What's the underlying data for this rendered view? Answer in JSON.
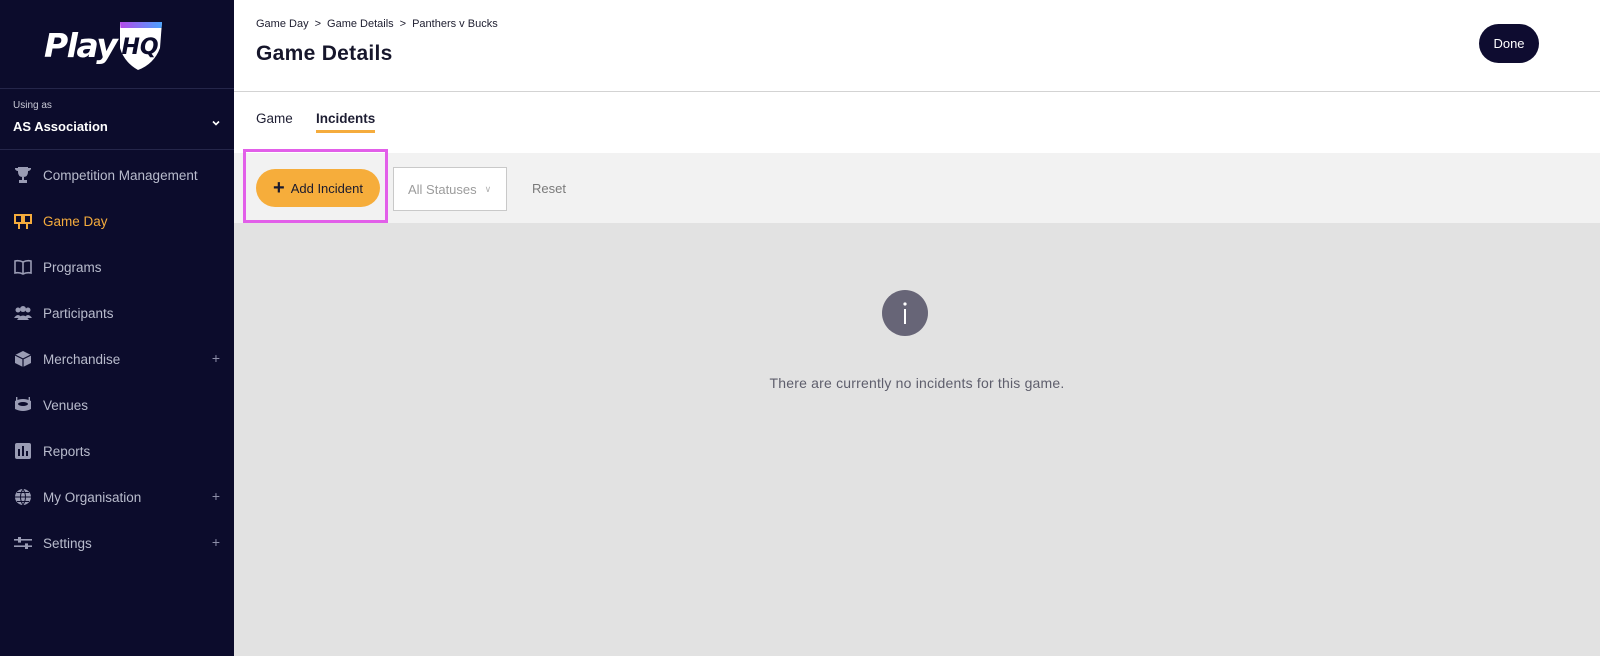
{
  "app": {
    "logo_text": "PlayHQ",
    "logo_word": "Play",
    "logo_badge": "HQ"
  },
  "org": {
    "caption": "Using as",
    "name": "AS Association"
  },
  "sidebar": {
    "items": [
      {
        "label": "Competition Management",
        "icon": "trophy-icon",
        "active": false,
        "expandable": false
      },
      {
        "label": "Game Day",
        "icon": "scoreboard-icon",
        "active": true,
        "expandable": false
      },
      {
        "label": "Programs",
        "icon": "book-icon",
        "active": false,
        "expandable": false
      },
      {
        "label": "Participants",
        "icon": "people-icon",
        "active": false,
        "expandable": false
      },
      {
        "label": "Merchandise",
        "icon": "box-icon",
        "active": false,
        "expandable": true
      },
      {
        "label": "Venues",
        "icon": "stadium-icon",
        "active": false,
        "expandable": false
      },
      {
        "label": "Reports",
        "icon": "bar-chart-icon",
        "active": false,
        "expandable": false
      },
      {
        "label": "My Organisation",
        "icon": "globe-icon",
        "active": false,
        "expandable": true
      },
      {
        "label": "Settings",
        "icon": "sliders-icon",
        "active": false,
        "expandable": true
      }
    ],
    "expand_symbol": "+"
  },
  "header": {
    "breadcrumb": [
      "Game Day",
      "Game Details",
      "Panthers v Bucks"
    ],
    "separator": ">",
    "title": "Game Details",
    "done_label": "Done"
  },
  "tabs": [
    {
      "label": "Game",
      "active": false
    },
    {
      "label": "Incidents",
      "active": true
    }
  ],
  "toolbar": {
    "add_label": "Add Incident",
    "status_select": "All Statuses",
    "reset_label": "Reset"
  },
  "content": {
    "empty_message": "There are currently no incidents for this game."
  },
  "colors": {
    "sidebar_bg": "#0c0c2c",
    "accent": "#f5ac3d",
    "highlight": "#e25fe9",
    "done_bg": "#0e0c30"
  }
}
